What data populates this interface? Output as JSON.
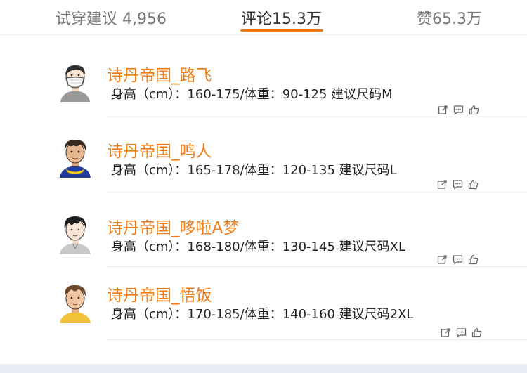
{
  "tabs": [
    {
      "label": "试穿建议 4,956",
      "active": false
    },
    {
      "label": "评论15.3万",
      "active": true
    },
    {
      "label": "赞65.3万",
      "active": false
    }
  ],
  "colors": {
    "accent": "#ef7d1a",
    "text": "#222222",
    "muted": "#777777"
  },
  "icons": {
    "share": "share-icon",
    "comment": "comment-icon",
    "like": "thumbs-up-icon"
  },
  "comments": [
    {
      "username": "诗丹帝国_路飞",
      "spec": "身高（cm）：160-175/体重：90-125   建议尺码M"
    },
    {
      "username": "诗丹帝国_鸣人",
      "spec": "身高（cm）：165-178/体重：120-135   建议尺码L"
    },
    {
      "username": "诗丹帝国_哆啦A梦",
      "spec": "身高（cm）：168-180/体重：130-145   建议尺码XL"
    },
    {
      "username": "诗丹帝国_悟饭",
      "spec": "身高（cm）：170-185/体重：140-160   建议尺码2XL"
    }
  ]
}
